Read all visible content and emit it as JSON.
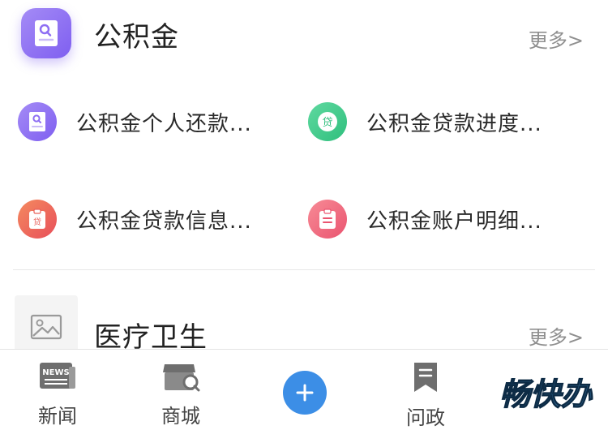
{
  "sections": [
    {
      "title": "公积金",
      "more": "更多>",
      "icon": "id-card-icon",
      "accent": "#8e6ef3",
      "items": [
        {
          "label": "公积金个人还款...",
          "icon": "id-card-icon",
          "color": "#8e6ef3"
        },
        {
          "label": "公积金贷款进度...",
          "icon": "loan-badge-icon",
          "color": "#3ec98b"
        },
        {
          "label": "公积金贷款信息...",
          "icon": "clipboard-loan-icon",
          "color": "#ef6b55"
        },
        {
          "label": "公积金账户明细...",
          "icon": "clipboard-list-icon",
          "color": "#f06a7a"
        }
      ]
    },
    {
      "title": "医疗卫生",
      "more": "更多>",
      "icon": "image-placeholder-icon"
    }
  ],
  "tabbar": {
    "items": [
      {
        "label": "新闻",
        "icon": "news-icon"
      },
      {
        "label": "商城",
        "icon": "shop-icon"
      },
      {
        "label": "",
        "icon": "plus-icon",
        "color": "#3c8ee6"
      },
      {
        "label": "问政",
        "icon": "bookmark-icon"
      }
    ],
    "brand": "畅快办",
    "brand_icon": "brand-logo"
  }
}
